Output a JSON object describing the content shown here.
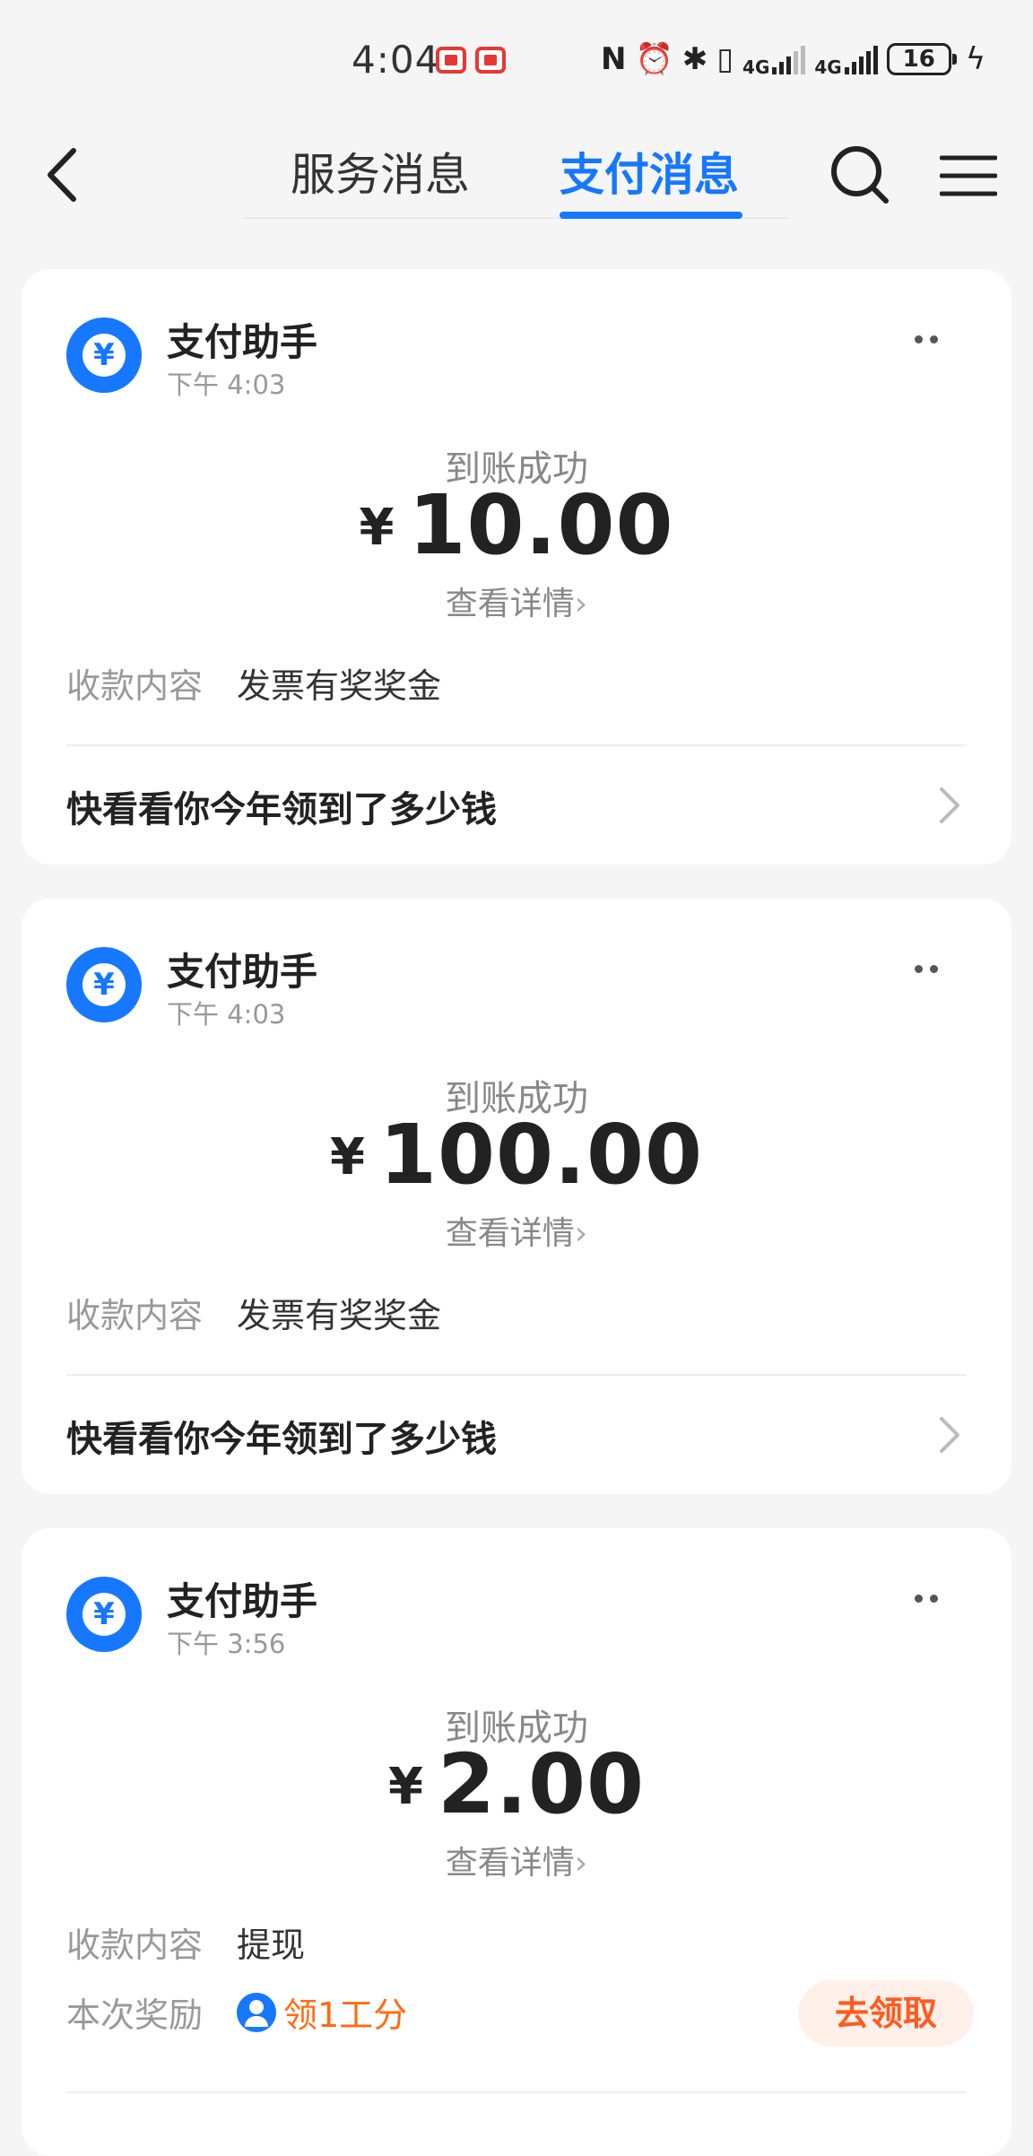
{
  "status_bar": {
    "time": "4:04",
    "network_4g_1": "4G",
    "network_4g_2": "4G",
    "battery": "16"
  },
  "nav": {
    "tabs": [
      {
        "label": "服务消息",
        "active": false
      },
      {
        "label": "支付消息",
        "active": true
      }
    ]
  },
  "messages": [
    {
      "sender": "支付助手",
      "time": "下午 4:03",
      "status": "到账成功",
      "currency": "¥",
      "amount": "10.00",
      "detail_link": "查看详情",
      "content_label": "收款内容",
      "content_value": "发票有奖奖金",
      "promo": "快看看你今年领到了多少钱"
    },
    {
      "sender": "支付助手",
      "time": "下午 4:03",
      "status": "到账成功",
      "currency": "¥",
      "amount": "100.00",
      "detail_link": "查看详情",
      "content_label": "收款内容",
      "content_value": "发票有奖奖金",
      "promo": "快看看你今年领到了多少钱"
    },
    {
      "sender": "支付助手",
      "time": "下午 3:56",
      "status": "到账成功",
      "currency": "¥",
      "amount": "2.00",
      "detail_link": "查看详情",
      "content_label": "收款内容",
      "content_value": "提现",
      "reward_label": "本次奖励",
      "reward_value": "领1工分",
      "claim_button": "去领取"
    }
  ],
  "colors": {
    "accent": "#1677ff",
    "reward": "#ff6a13",
    "background": "#f5f5f5"
  }
}
